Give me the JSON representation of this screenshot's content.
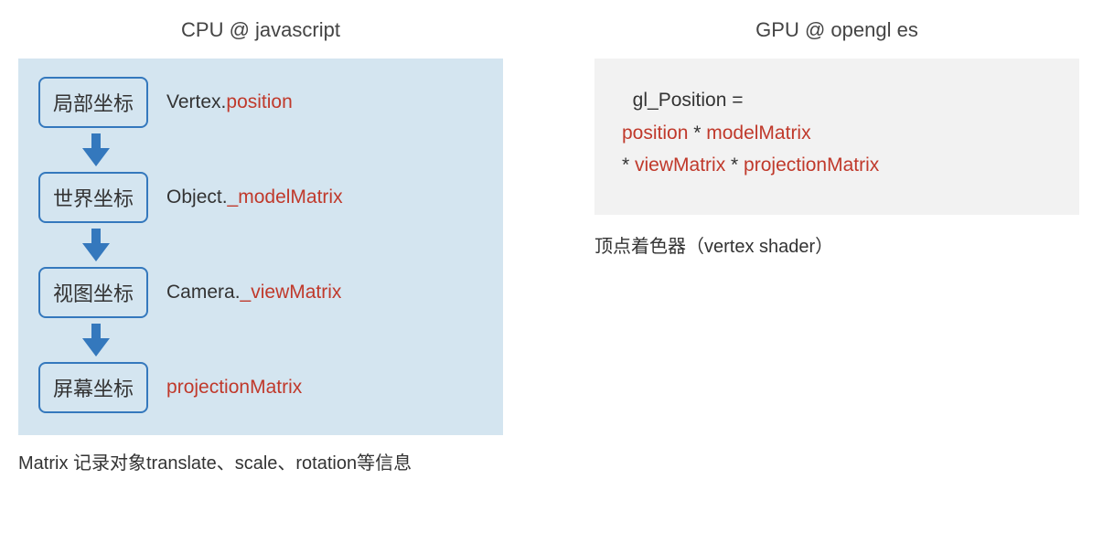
{
  "left": {
    "title": "CPU @ javascript",
    "steps": [
      {
        "box": "局部坐标",
        "label_prefix": "Vertex.",
        "label_hl": "position"
      },
      {
        "box": "世界坐标",
        "label_prefix": "Object.",
        "label_hl": "_modelMatrix"
      },
      {
        "box": "视图坐标",
        "label_prefix": "Camera.",
        "label_hl": "_viewMatrix"
      },
      {
        "box": "屏幕坐标",
        "label_prefix": "",
        "label_hl": "projectionMatrix"
      }
    ],
    "caption": "Matrix 记录对象translate、scale、rotation等信息"
  },
  "right": {
    "title": "GPU @ opengl es",
    "code": {
      "line1_plain": "gl_Position =",
      "line2_hl1": "position",
      "line2_mul": " * ",
      "line2_hl2": "modelMatrix",
      "line3_mul1": "* ",
      "line3_hl1": "viewMatrix",
      "line3_mul2": " * ",
      "line3_hl2": "projectionMatrix"
    },
    "caption": "顶点着色器（vertex shader）"
  },
  "colors": {
    "accent_blue": "#3478bd",
    "accent_red": "#c0392b",
    "panel_left_bg": "#d4e5f0",
    "panel_right_bg": "#f2f2f2"
  }
}
